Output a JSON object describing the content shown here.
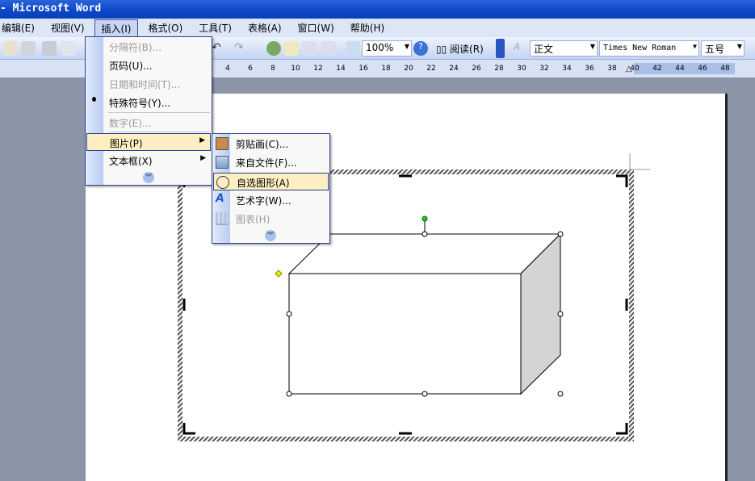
{
  "window": {
    "title": "- Microsoft Word"
  },
  "menubar": [
    "编辑(E)",
    "视图(V)",
    "插入(I)",
    "格式(O)",
    "工具(T)",
    "表格(A)",
    "窗口(W)",
    "帮助(H)"
  ],
  "toolbar": {
    "zoom": "100%",
    "read_label": "阅读(R)",
    "style": "正文",
    "font": "Times New Roman",
    "size": "五号"
  },
  "ruler": {
    "ticks": [
      "4",
      "6",
      "8",
      "10",
      "12",
      "14",
      "16",
      "18",
      "20",
      "22",
      "24",
      "26",
      "28",
      "30",
      "32",
      "34",
      "36",
      "38",
      "40",
      "42",
      "44",
      "46",
      "48"
    ]
  },
  "insert_menu": {
    "items": [
      {
        "label": "分隔符(B)...",
        "disabled": true
      },
      {
        "label": "页码(U)...",
        "disabled": false
      },
      {
        "label": "日期和时间(T)...",
        "disabled": true
      },
      {
        "label": "特殊符号(Y)...",
        "disabled": false
      },
      {
        "label": "数字(E)...",
        "disabled": true
      },
      {
        "label": "图片(P)",
        "disabled": false
      },
      {
        "label": "文本框(X)",
        "disabled": false
      }
    ]
  },
  "picture_submenu": {
    "items": [
      {
        "label": "剪贴画(C)...",
        "icon": "clipart-icon"
      },
      {
        "label": "来自文件(F)...",
        "icon": "image-file-icon"
      },
      {
        "label": "自选图形(A)",
        "icon": "autoshape-icon"
      },
      {
        "label": "艺术字(W)...",
        "icon": "wordart-icon"
      },
      {
        "label": "图表(H)",
        "icon": "chart-icon"
      }
    ]
  }
}
